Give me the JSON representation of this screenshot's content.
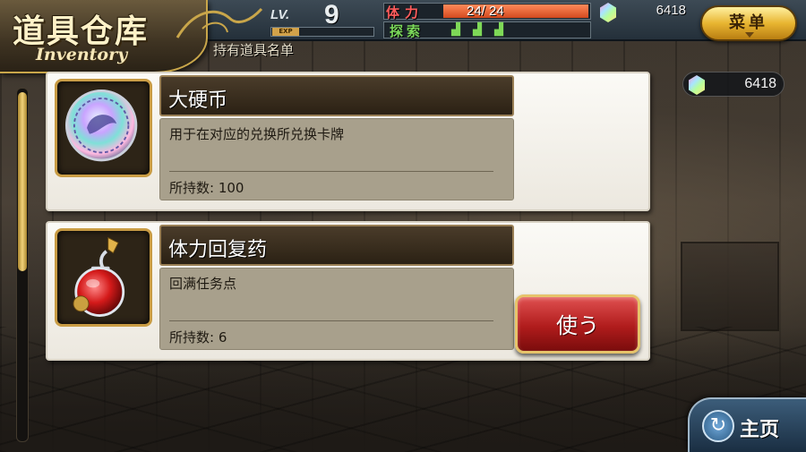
{
  "header": {
    "title": "道具仓库",
    "subtitle": "Inventory",
    "list_title": "持有道具名单"
  },
  "status": {
    "level_label": "LV.",
    "level_value": "9",
    "exp_label": "EXP",
    "exp_fraction": 0.0,
    "stamina_label": "体力",
    "stamina_text": "24/ 24",
    "stamina_fraction": 1.0,
    "explore_label": "探索",
    "explore_icons": [
      "boot-icon",
      "boot-icon",
      "boot-icon"
    ],
    "gems_top": "6418",
    "gems_side": "6418"
  },
  "menu": {
    "label": "菜单"
  },
  "items": [
    {
      "name": "大硬币",
      "description": "用于在对应的兑换所兑换卡牌",
      "quantity": "所持数: 100",
      "icon": "coin-icon"
    },
    {
      "name": "体力回复药",
      "description": "回满任务点",
      "quantity": "所持数: 6",
      "icon": "potion-icon",
      "use_label": "使う"
    }
  ],
  "home": {
    "label": "主页"
  },
  "colors": {
    "stamina": "#ff5c5c",
    "explore": "#7bd85a",
    "menu_gold": "#e8b531",
    "use_red": "#b01c1c",
    "home_blue": "#1a2e42"
  }
}
